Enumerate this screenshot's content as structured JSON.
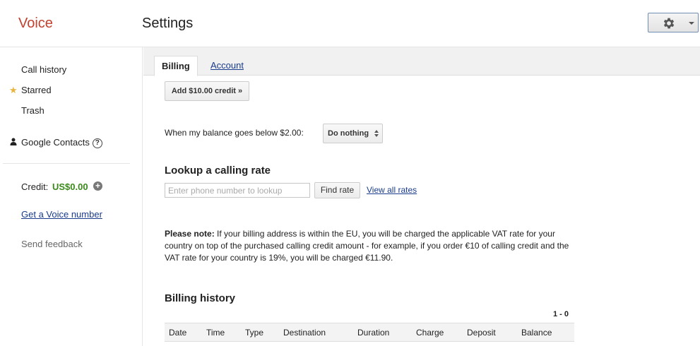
{
  "header": {
    "logo": "Voice",
    "title": "Settings",
    "settings_icon": "gear-icon"
  },
  "sidebar": {
    "items": [
      {
        "label": "Call history"
      },
      {
        "label": "Starred",
        "icon": "star-icon"
      },
      {
        "label": "Trash"
      },
      {
        "label": "Google Contacts",
        "icon": "person-icon",
        "help": "?"
      }
    ],
    "credit_label": "Credit:",
    "credit_value": "US$0.00",
    "add_credit_icon": "+",
    "voice_number_link": "Get a Voice number",
    "feedback": "Send feedback"
  },
  "main": {
    "tabs": [
      {
        "label": "Billing",
        "active": true
      },
      {
        "label": "Account",
        "active": false
      }
    ],
    "add_credit_button": "Add $10.00 credit »",
    "balance_label": "When my balance goes below $2.00:",
    "balance_action": "Do nothing",
    "lookup_title": "Lookup a calling rate",
    "lookup_placeholder": "Enter phone number to lookup",
    "find_rate_button": "Find rate",
    "view_all_rates": "View all rates",
    "note_bold": "Please note:",
    "note_text": " If your billing address is within the EU, you will be charged the applicable VAT rate for your country on top of the purchased calling credit amount - for example, if you order €10 of calling credit and the VAT rate for your country is 19%, you will be charged €11.90.",
    "history_title": "Billing history",
    "history_range": "1 - 0",
    "history_columns": [
      "Date",
      "Time",
      "Type",
      "Destination",
      "Duration",
      "Charge",
      "Deposit",
      "Balance"
    ]
  },
  "colors": {
    "logo": "#c4402f",
    "link": "#1a3c8c",
    "credit": "#3a8a1a",
    "star": "#e8b43c"
  }
}
